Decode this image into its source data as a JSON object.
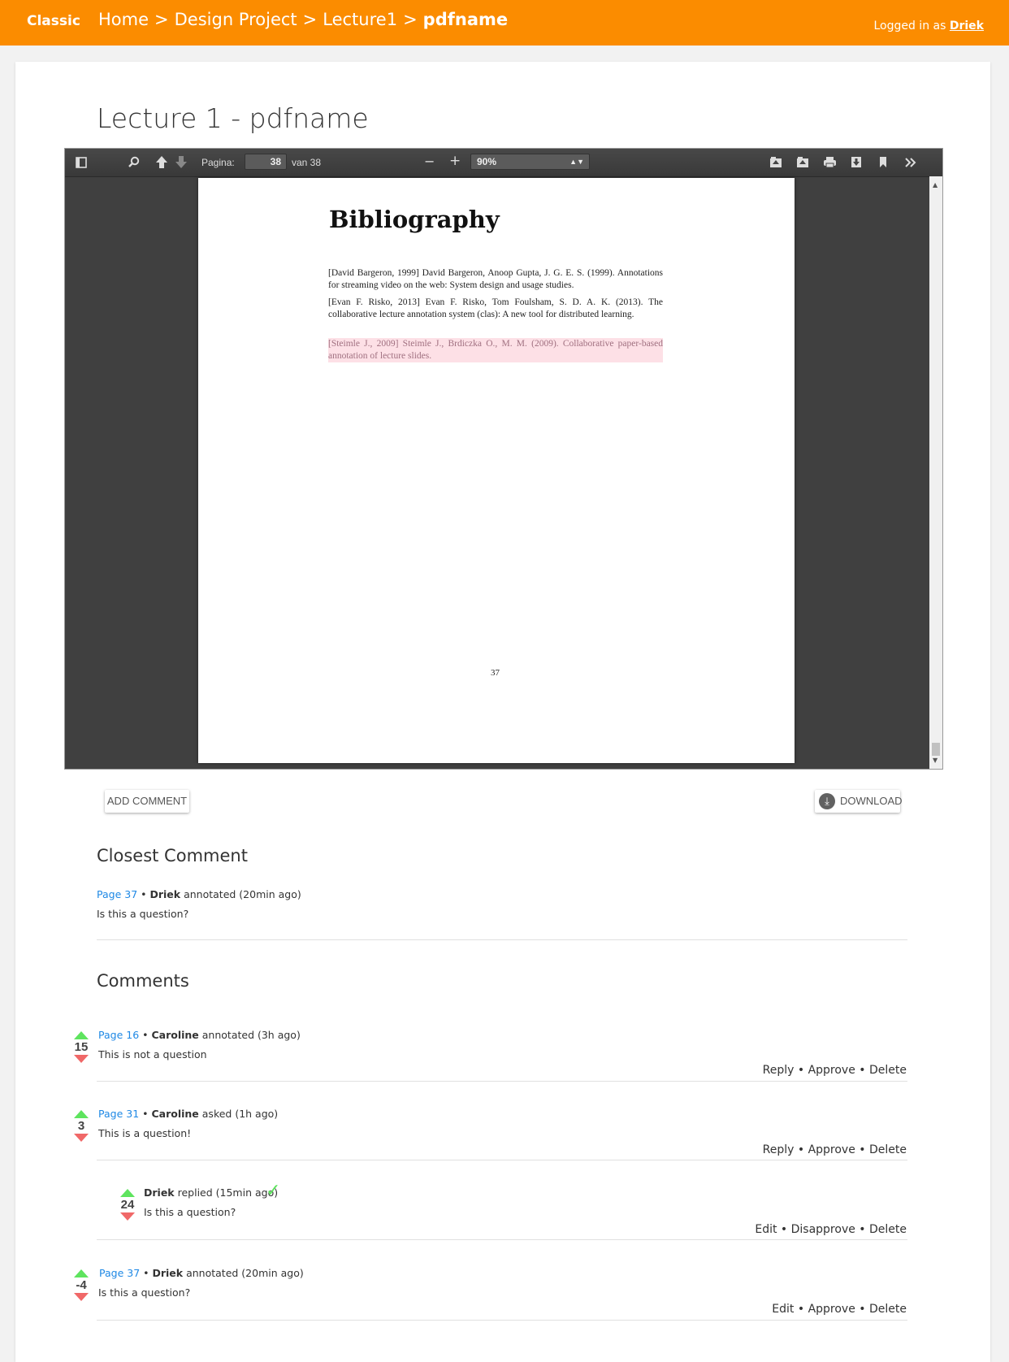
{
  "topbar": {
    "brand": "Classic",
    "breadcrumb": [
      "Home",
      "Design Project",
      "Lecture1",
      "pdfname"
    ],
    "separator": ">",
    "login_prefix": "Logged in as",
    "login_user": "Driek"
  },
  "page_title": "Lecture 1 - pdfname",
  "viewer": {
    "page_label": "Pagina:",
    "page_value": "38",
    "page_total": "van 38",
    "zoom_value": "90%",
    "zoom_minus": "−",
    "zoom_plus": "+",
    "icons": [
      "sidebar-toggle-icon",
      "search-icon",
      "previous-page-icon",
      "next-page-icon",
      "zoom-out-icon",
      "zoom-in-icon",
      "presentation-mode-icon",
      "open-file-icon",
      "print-icon",
      "download-icon",
      "bookmark-icon",
      "tools-icon"
    ],
    "document": {
      "heading": "Bibliography",
      "entries": [
        "[David Bargeron, 1999] David Bargeron, Anoop Gupta, J. G. E. S. (1999). Annotations for streaming video on the web: System design and usage studies.",
        "[Evan F. Risko, 2013] Evan F. Risko, Tom Foulsham, S. D. A. K. (2013). The collaborative lecture annotation system (clas): A new tool for distributed learning.",
        "[Steimle J., 2009] Steimle J., Brdiczka O., M. M. (2009). Collaborative paper-based annotation of lecture slides."
      ],
      "page_number": "37"
    }
  },
  "buttons": {
    "add_comment": "ADD COMMENT",
    "download": "DOWNLOAD"
  },
  "closest": {
    "heading": "Closest Comment",
    "page": "Page 37",
    "author": "Driek",
    "verb": "annotated (20min ago)",
    "text": "Is this a question?"
  },
  "comments_heading": "Comments",
  "comments": [
    {
      "votes": "15",
      "page": "Page 16",
      "author": "Caroline",
      "verb": "annotated (3h ago)",
      "text": "This is not a question",
      "actions": "Reply • Approve • Delete"
    },
    {
      "votes": "3",
      "page": "Page 31",
      "author": "Caroline",
      "verb": "asked (1h ago)",
      "text": "This is a question!",
      "actions": "Reply • Approve • Delete"
    },
    {
      "votes": "24",
      "page": "",
      "author": "Driek",
      "verb": "replied (15min ago)",
      "text": "Is this a question?",
      "actions": "Edit • Disapprove • Delete",
      "approved": true
    },
    {
      "votes": "-4",
      "page": "Page 37",
      "author": "Driek",
      "verb": "annotated (20min ago)",
      "text": "Is this a question?",
      "actions": "Edit • Approve • Delete"
    }
  ],
  "colors": {
    "topbar": "#fb8c00",
    "link": "#1e88e5",
    "upvote": "#5ee45e",
    "downvote": "#f06868",
    "highlight": "#fde0e6"
  }
}
